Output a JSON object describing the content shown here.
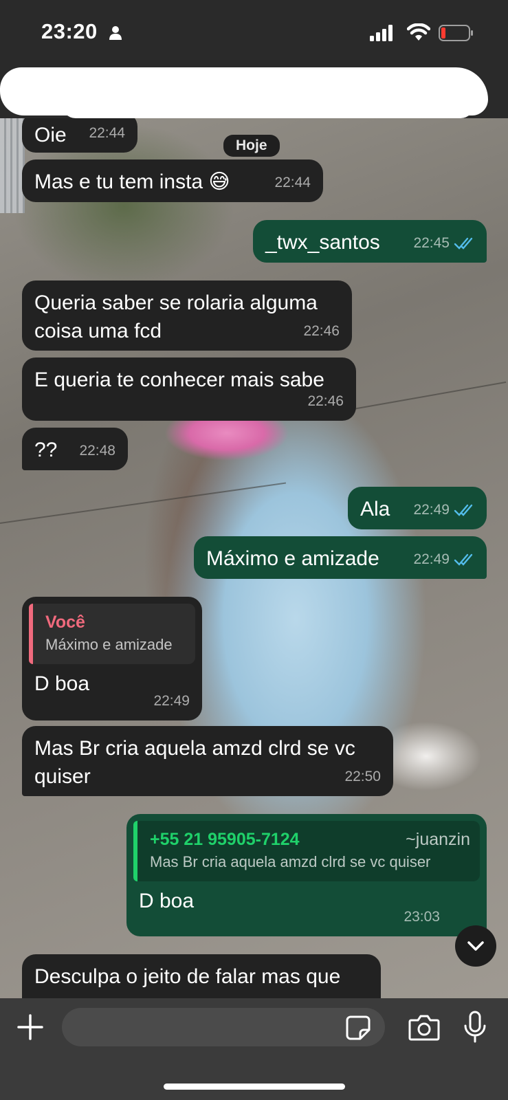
{
  "status_bar": {
    "time": "23:20",
    "icons": [
      "person-icon",
      "signal-icon",
      "wifi-icon",
      "battery-icon"
    ],
    "battery_color": "#ff3b30"
  },
  "header": {
    "back_icon": "back-chevron-icon",
    "contact_name_redacted": true
  },
  "chat": {
    "date_pill": "Hoje",
    "messages": [
      {
        "direction": "in",
        "text": "Oie",
        "time": "22:44"
      },
      {
        "direction": "in",
        "text": "Mas e tu tem insta 😅",
        "time": "22:44"
      },
      {
        "direction": "out",
        "text": "_twx_santos",
        "time": "22:45",
        "status": "read"
      },
      {
        "direction": "in",
        "text": "Queria saber se rolaria alguma coisa uma fcd",
        "time": "22:46"
      },
      {
        "direction": "in",
        "text": "E queria te conhecer mais sabe",
        "time": "22:46"
      },
      {
        "direction": "in",
        "text": "??",
        "time": "22:48"
      },
      {
        "direction": "out",
        "text": "Ala",
        "time": "22:49",
        "status": "read"
      },
      {
        "direction": "out",
        "text": "Máximo e amizade",
        "time": "22:49",
        "status": "read"
      },
      {
        "direction": "in",
        "quote": {
          "author": "Você",
          "text": "Máximo e amizade"
        },
        "text": "D boa",
        "time": "22:49"
      },
      {
        "direction": "in",
        "text": "Mas Br cria aquela amzd clrd se vc quiser",
        "time": "22:50"
      },
      {
        "direction": "out",
        "quote": {
          "author": "+55 21 95905-7124",
          "alias": "~juanzin",
          "text": "Mas Br cria aquela amzd clrd se vc quiser"
        },
        "text": "D boa",
        "time": "23:03"
      },
      {
        "direction": "in",
        "text": "Desculpa o jeito de falar mas que"
      }
    ],
    "colors": {
      "incoming_bubble": "#222222",
      "outgoing_bubble": "#134d37",
      "read_ticks": "#53bdeb",
      "quote_you": "#f06a7d",
      "quote_other": "#1fd16a"
    }
  },
  "input_bar": {
    "placeholder": "",
    "icons": [
      "plus-icon",
      "sticker-icon",
      "camera-icon",
      "mic-icon"
    ]
  }
}
